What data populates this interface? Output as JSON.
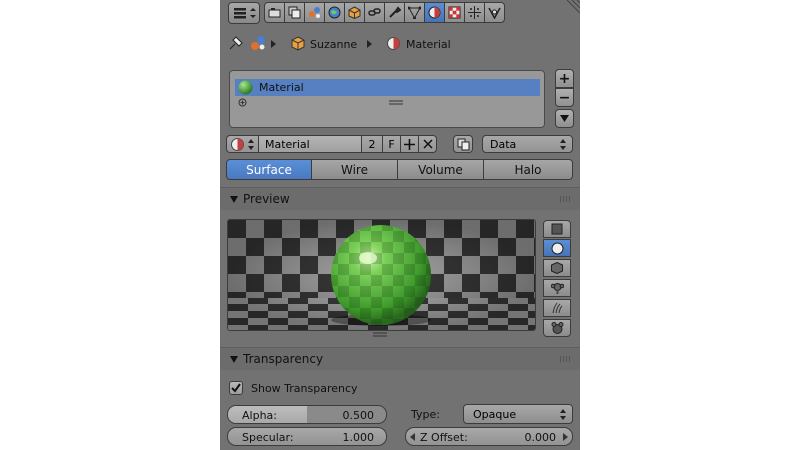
{
  "header": {
    "tabs": [
      "render-tab",
      "render-layers-tab",
      "scene-tab",
      "world-tab",
      "object-tab",
      "constraints-tab",
      "modifiers-tab",
      "data-tab",
      "material-tab",
      "texture-tab",
      "particles-tab",
      "physics-tab"
    ],
    "active_tab": "material-tab"
  },
  "breadcrumb": {
    "object": "Suzanne",
    "material": "Material"
  },
  "material_slots": {
    "items": [
      "Material"
    ]
  },
  "datablock": {
    "name": "Material",
    "users": "2",
    "fake_user": "F",
    "link": "Data"
  },
  "type_tabs": {
    "items": [
      "Surface",
      "Wire",
      "Volume",
      "Halo"
    ],
    "active": "Surface"
  },
  "preview": {
    "title": "Preview"
  },
  "transparency": {
    "title": "Transparency",
    "show_label": "Show Transparency",
    "show_checked": true,
    "alpha_label": "Alpha:",
    "alpha_value": "0.500",
    "alpha_fraction": 0.5,
    "type_label": "Type:",
    "type_value": "Opaque",
    "specular_label": "Specular:",
    "specular_value": "1.000",
    "zoffset_label": "Z Offset:",
    "zoffset_value": "0.000"
  },
  "colors": {
    "panel": "#727272",
    "accent": "#5680c2",
    "material_green": "#4aa83a"
  }
}
